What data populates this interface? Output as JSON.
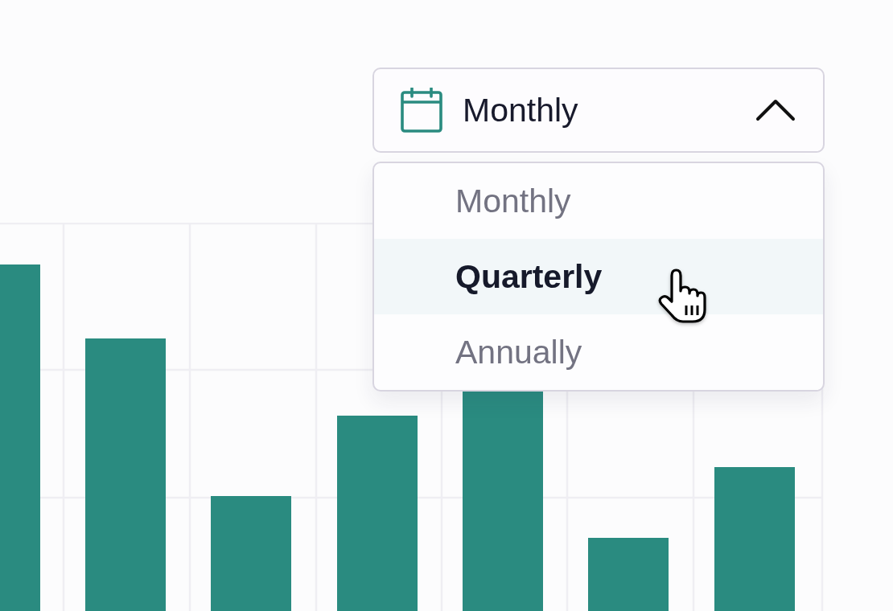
{
  "dropdown": {
    "value": "Monthly",
    "expanded": true,
    "options": [
      {
        "label": "Monthly",
        "highlighted": false
      },
      {
        "label": "Quarterly",
        "highlighted": true
      },
      {
        "label": "Annually",
        "highlighted": false
      }
    ]
  }
}
